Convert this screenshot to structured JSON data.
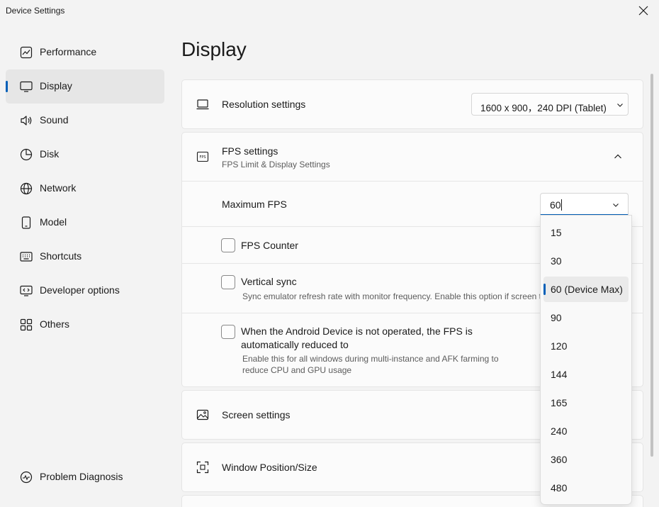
{
  "window": {
    "title": "Device Settings"
  },
  "sidebar": {
    "items": [
      {
        "label": "Performance",
        "icon": "performance-icon"
      },
      {
        "label": "Display",
        "icon": "display-icon",
        "active": true
      },
      {
        "label": "Sound",
        "icon": "sound-icon"
      },
      {
        "label": "Disk",
        "icon": "disk-icon"
      },
      {
        "label": "Network",
        "icon": "network-icon"
      },
      {
        "label": "Model",
        "icon": "model-icon"
      },
      {
        "label": "Shortcuts",
        "icon": "keyboard-icon"
      },
      {
        "label": "Developer options",
        "icon": "developer-icon"
      },
      {
        "label": "Others",
        "icon": "grid-icon"
      }
    ],
    "footer": {
      "label": "Problem Diagnosis",
      "icon": "diagnosis-icon"
    }
  },
  "main": {
    "title": "Display",
    "resolution": {
      "title": "Resolution settings",
      "value": "1600 x 900，240 DPI (Tablet)"
    },
    "fps": {
      "title": "FPS settings",
      "subtitle": "FPS Limit & Display Settings",
      "max_fps_label": "Maximum FPS",
      "max_fps_value": "60",
      "counter_label": "FPS Counter",
      "vsync_label": "Vertical sync",
      "vsync_desc": "Sync emulator refresh rate with monitor frequency. Enable this option if screen t",
      "auto_reduce_label_1": "When the Android Device is not operated, the FPS is",
      "auto_reduce_label_2": "automatically reduced to",
      "auto_reduce_desc_1": "Enable this for all windows during multi-instance and AFK farming to",
      "auto_reduce_desc_2": "reduce CPU and GPU usage"
    },
    "screen": {
      "title": "Screen settings"
    },
    "window_pos": {
      "title": "Window Position/Size"
    }
  },
  "fps_dropdown": {
    "options": [
      "15",
      "30",
      "60 (Device Max)",
      "90",
      "120",
      "144",
      "165",
      "240",
      "360",
      "480"
    ],
    "selected_index": 2
  },
  "colors": {
    "accent": "#005fb8",
    "background": "#f3f3f3",
    "card": "#fbfbfb"
  }
}
